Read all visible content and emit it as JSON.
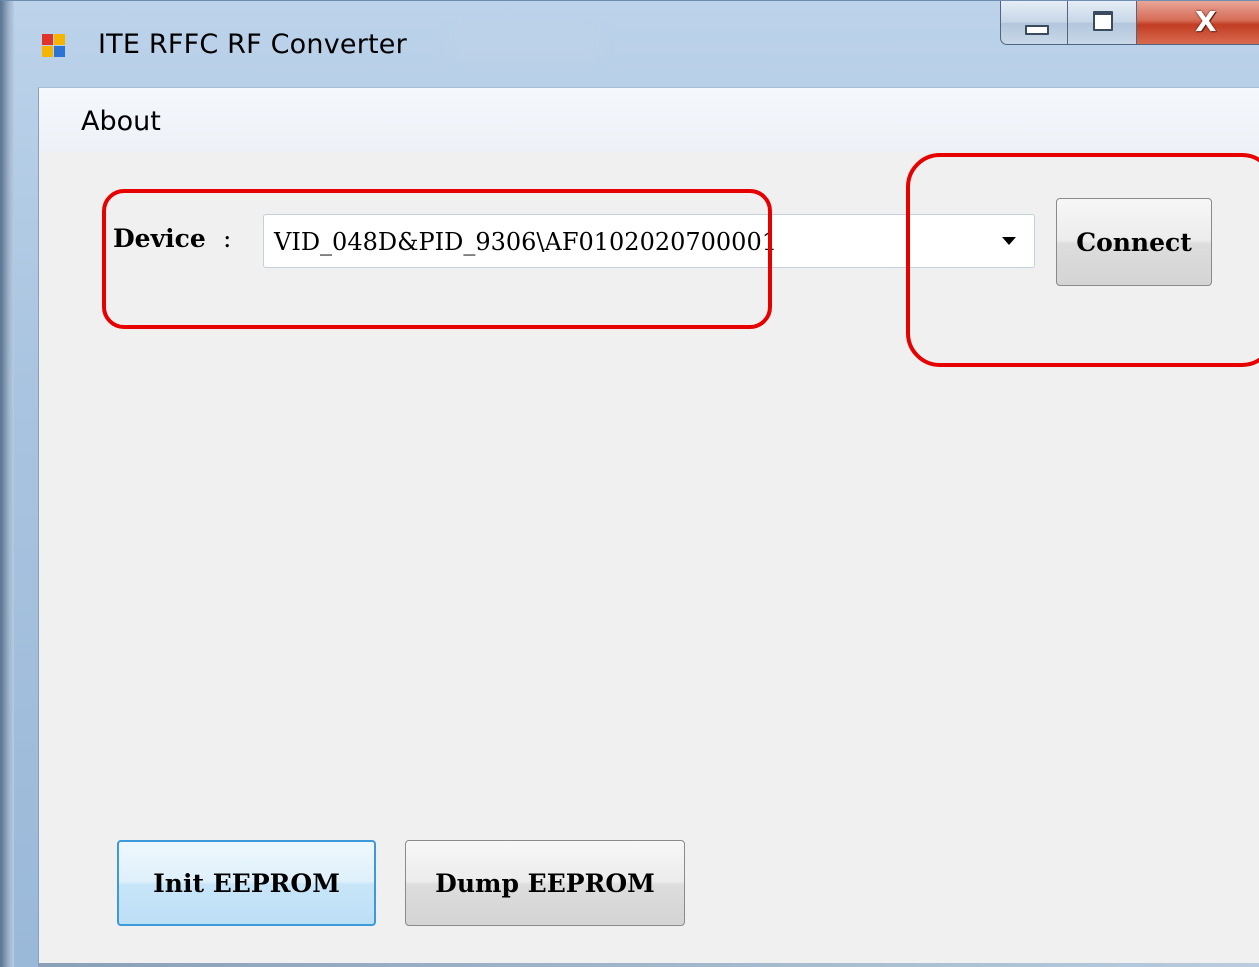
{
  "window": {
    "title": "ITE RFFC RF Converter",
    "controls": {
      "minimize_icon": "minimize-icon",
      "maximize_icon": "maximize-icon",
      "close_glyph": "X"
    }
  },
  "menu": {
    "items": [
      {
        "label": "About"
      }
    ]
  },
  "device": {
    "label": "Device",
    "colon": ":",
    "selected_value": "VID_048D&PID_9306\\AF0102020700001",
    "dropdown_icon": "chevron-down-icon"
  },
  "buttons": {
    "connect": "Connect",
    "init_eeprom": "Init EEPROM",
    "dump_eeprom": "Dump EEPROM"
  },
  "colors": {
    "annotation": "#e60000",
    "focus_border": "#3c9ad8",
    "client_background": "#f0f0f0"
  }
}
